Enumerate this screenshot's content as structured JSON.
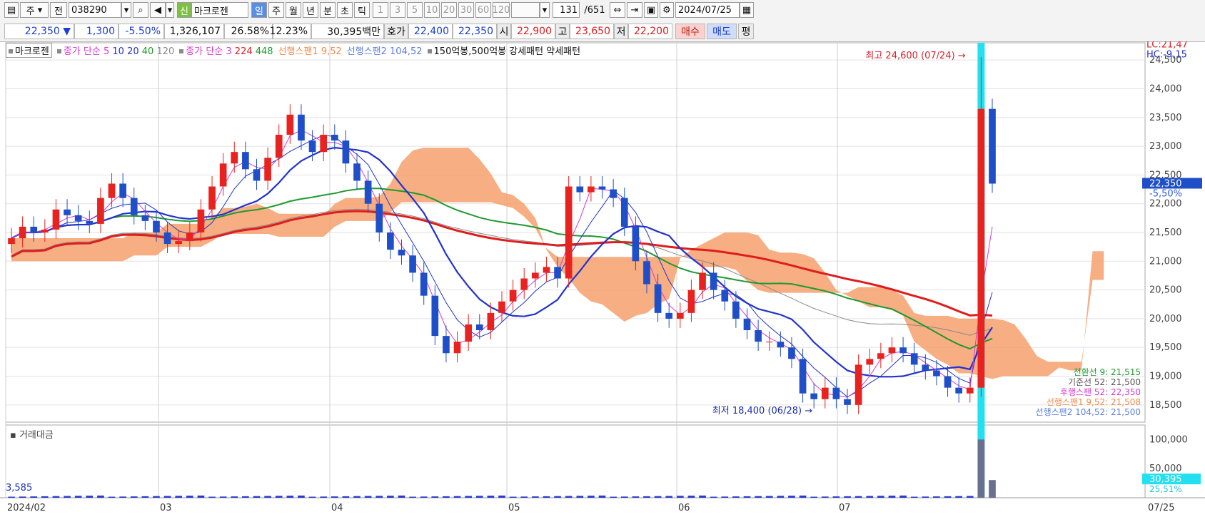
{
  "toolbar": {
    "period_label": "주",
    "prev_label": "전",
    "code": "038290",
    "badge": "신",
    "name": "마크로젠",
    "periods": [
      "일",
      "주",
      "월",
      "년",
      "분",
      "초",
      "틱"
    ],
    "ticks": [
      "1",
      "3",
      "5",
      "10",
      "20",
      "30",
      "60",
      "120"
    ],
    "count": "131",
    "total": "/651",
    "date": "2024/07/25"
  },
  "quote": {
    "price": "22,350 ▼",
    "change": "1,300",
    "change_pct": "-5.50%",
    "volume": "1,326,107",
    "turnover_pct": "26.58%",
    "ratio": "12.23%",
    "amount": "30,395백만",
    "hoga_label": "호가",
    "ask": "22,400",
    "bid": "22,350",
    "open_label": "시",
    "open": "22,900",
    "high_label": "고",
    "high": "23,650",
    "low_label": "저",
    "low": "22,200",
    "buy": "매수",
    "sell": "매도",
    "eval": "평"
  },
  "legend": {
    "stock": "마크로젠",
    "ma1": "종가 단순 5",
    "ma1_b": "10",
    "ma1_c": "20",
    "ma1_d": "40",
    "ma1_e": "120",
    "ma2": "종가 단순 3",
    "ma2_b": "224",
    "ma2_c": "448",
    "span1": "선행스팬1 9,52",
    "span2": "선행스팬2 104,52",
    "pattern": "150억봉,500억봉 강세패턴   약세패턴"
  },
  "colors": {
    "up": "#e8231f",
    "down": "#1f4fc8",
    "cloud_up": "#f4a06c",
    "cloud_down": "#6f8fe8",
    "ma5": "#d43bd0",
    "ma20": "#2233cc",
    "ma40": "#1e9a2e",
    "ma224": "#e01c1c",
    "ma448": "#888888",
    "highlight": "#22e0f0"
  },
  "chart_data": {
    "type": "candlestick",
    "title": "마크로젠",
    "x": [
      "2024/02",
      "03",
      "04",
      "05",
      "06",
      "07",
      "07/25"
    ],
    "ylim": [
      18200,
      24800
    ],
    "yticks": [
      "18,500",
      "19,000",
      "19,500",
      "20,000",
      "20,500",
      "21,000",
      "21,500",
      "22,000",
      "22,500",
      "23,000",
      "23,500",
      "24,000",
      "24,500"
    ],
    "annotations": {
      "high": "최고 24,600 (07/24)",
      "low": "최저 18,400 (06/28)"
    },
    "right_labels": {
      "lc": "LC:21,47",
      "hc": "HC:-9,15",
      "price": "22,350",
      "pct": "-5,50%"
    },
    "indicators": [
      "전환선 9: 21,515",
      "기준선 52: 21,500",
      "후행스팬 52: 22,350",
      "선행스팬1 9,52: 21,508",
      "선행스팬2 104,52: 21,500"
    ],
    "series": [
      {
        "name": "close",
        "values": [
          21400,
          21600,
          21500,
          21550,
          21900,
          21800,
          21700,
          21650,
          22100,
          22350,
          22100,
          21800,
          21700,
          21500,
          21300,
          21350,
          21500,
          21900,
          22300,
          22700,
          22900,
          22600,
          22400,
          22800,
          23200,
          23550,
          23100,
          22900,
          23200,
          23100,
          22700,
          22400,
          22000,
          21500,
          21200,
          21100,
          20800,
          20400,
          19700,
          19400,
          19600,
          19900,
          19800,
          20100,
          20300,
          20500,
          20700,
          20800,
          20900,
          20700,
          22300,
          22200,
          22300,
          22250,
          22100,
          21600,
          21000,
          20600,
          20100,
          20000,
          20100,
          20500,
          20800,
          20500,
          20300,
          20000,
          19800,
          19600,
          19600,
          19500,
          19300,
          18700,
          18600,
          18800,
          18600,
          18500,
          19200,
          19300,
          19400,
          19500,
          19400,
          19200,
          19100,
          19000,
          18800,
          18700,
          18800,
          23650,
          22350
        ]
      }
    ],
    "volume": {
      "label": "거래대금",
      "yticks": [
        "50,000",
        "100,000"
      ],
      "left_value": "3,585",
      "value": "30,395",
      "pct": "25,51%"
    },
    "xlabels": [
      "2024/02",
      "03",
      "04",
      "05",
      "06",
      "07",
      "07/25"
    ]
  }
}
